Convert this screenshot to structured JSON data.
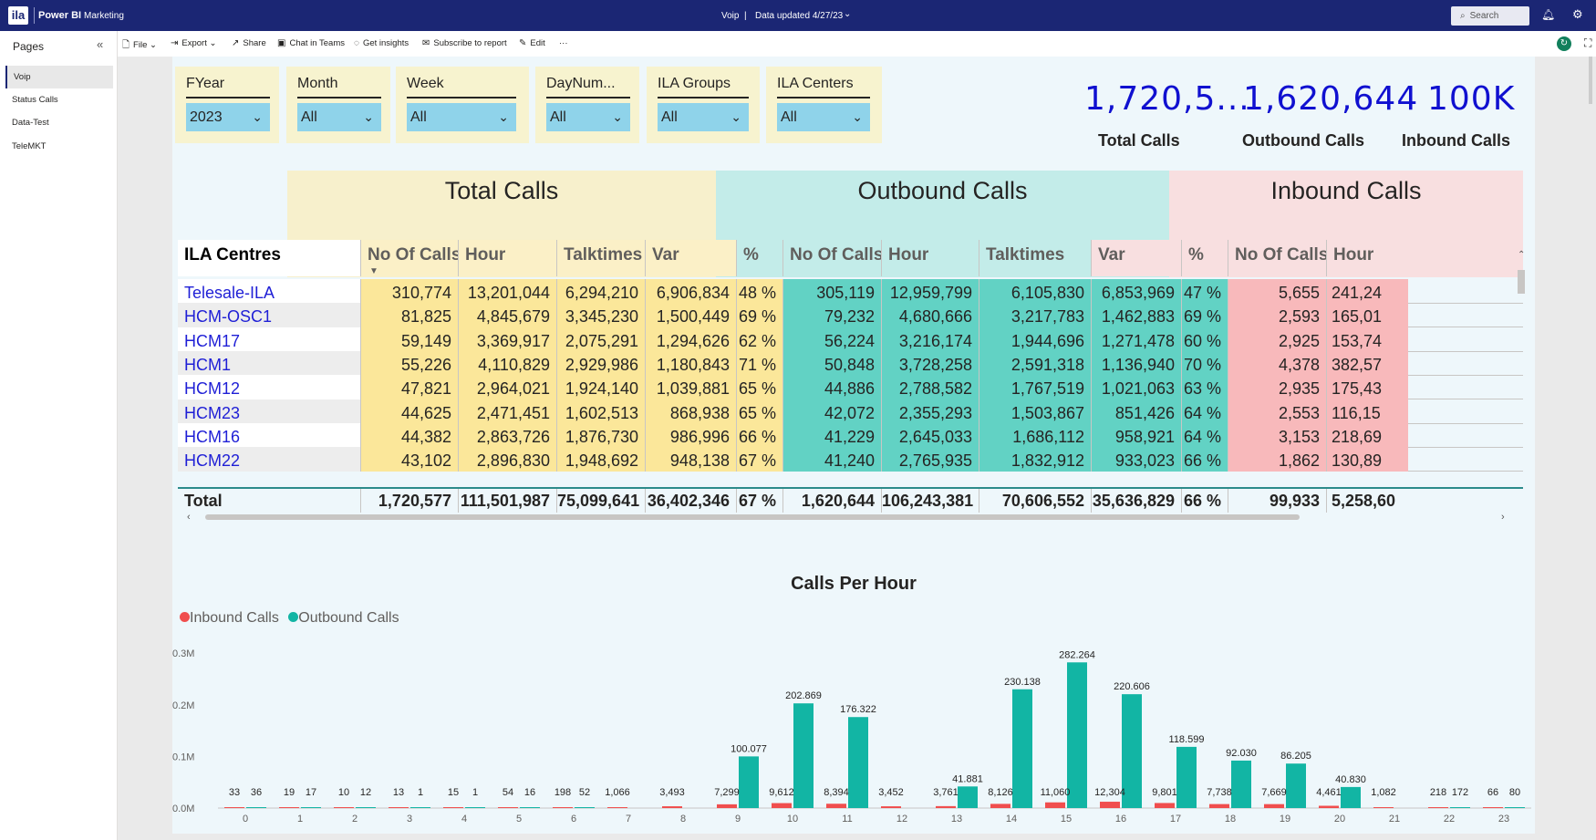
{
  "app": {
    "logo_text": "ila",
    "name": "Power BI",
    "workspace": "Marketing"
  },
  "report": {
    "title": "Voip",
    "separator": "|",
    "data_updated": "Data updated 4/27/23"
  },
  "search": {
    "placeholder": "Search"
  },
  "pages": {
    "title": "Pages",
    "items": [
      {
        "label": "Voip"
      },
      {
        "label": "Status Calls"
      },
      {
        "label": "Data-Test"
      },
      {
        "label": "TeleMKT"
      }
    ]
  },
  "toolbar": {
    "file": "File",
    "export": "Export",
    "share": "Share",
    "teams": "Chat in Teams",
    "insights": "Get insights",
    "subscribe": "Subscribe to report",
    "edit": "Edit",
    "more": "···"
  },
  "slicers": [
    {
      "title": "FYear",
      "value": "2023"
    },
    {
      "title": "Month",
      "value": "All"
    },
    {
      "title": "Week",
      "value": "All"
    },
    {
      "title": "DayNum...",
      "value": "All"
    },
    {
      "title": "ILA Groups",
      "value": "All"
    },
    {
      "title": "ILA Centers",
      "value": "All"
    }
  ],
  "kpis": [
    {
      "value": "1,720,5...",
      "label": "Total Calls"
    },
    {
      "value": "1,620,644",
      "label": "Outbound Calls"
    },
    {
      "value": "100K",
      "label": "Inbound Calls"
    }
  ],
  "matrix": {
    "group_titles": {
      "total": "Total Calls",
      "outbound": "Outbound Calls",
      "inbound": "Inbound Calls"
    },
    "columns": [
      "ILA Centres",
      "No Of Calls",
      "Hour",
      "Talktimes",
      "Var",
      "%",
      "No Of Calls",
      "Hour",
      "Talktimes",
      "Var",
      "%",
      "No Of Calls",
      "Hour"
    ],
    "rows": [
      {
        "name": "Telesale-ILA",
        "values": [
          "310,774",
          "13,201,044",
          "6,294,210",
          "6,906,834",
          "48 %",
          "305,119",
          "12,959,799",
          "6,105,830",
          "6,853,969",
          "47 %",
          "5,655",
          "241,24"
        ]
      },
      {
        "name": "HCM-OSC1",
        "values": [
          "81,825",
          "4,845,679",
          "3,345,230",
          "1,500,449",
          "69 %",
          "79,232",
          "4,680,666",
          "3,217,783",
          "1,462,883",
          "69 %",
          "2,593",
          "165,01"
        ]
      },
      {
        "name": "HCM17",
        "values": [
          "59,149",
          "3,369,917",
          "2,075,291",
          "1,294,626",
          "62 %",
          "56,224",
          "3,216,174",
          "1,944,696",
          "1,271,478",
          "60 %",
          "2,925",
          "153,74"
        ]
      },
      {
        "name": "HCM1",
        "values": [
          "55,226",
          "4,110,829",
          "2,929,986",
          "1,180,843",
          "71 %",
          "50,848",
          "3,728,258",
          "2,591,318",
          "1,136,940",
          "70 %",
          "4,378",
          "382,57"
        ]
      },
      {
        "name": "HCM12",
        "values": [
          "47,821",
          "2,964,021",
          "1,924,140",
          "1,039,881",
          "65 %",
          "44,886",
          "2,788,582",
          "1,767,519",
          "1,021,063",
          "63 %",
          "2,935",
          "175,43"
        ]
      },
      {
        "name": "HCM23",
        "values": [
          "44,625",
          "2,471,451",
          "1,602,513",
          "868,938",
          "65 %",
          "42,072",
          "2,355,293",
          "1,503,867",
          "851,426",
          "64 %",
          "2,553",
          "116,15"
        ]
      },
      {
        "name": "HCM16",
        "values": [
          "44,382",
          "2,863,726",
          "1,876,730",
          "986,996",
          "66 %",
          "41,229",
          "2,645,033",
          "1,686,112",
          "958,921",
          "64 %",
          "3,153",
          "218,69"
        ]
      },
      {
        "name": "HCM22",
        "values": [
          "43,102",
          "2,896,830",
          "1,948,692",
          "948,138",
          "67 %",
          "41,240",
          "2,765,935",
          "1,832,912",
          "933,023",
          "66 %",
          "1,862",
          "130,89"
        ]
      }
    ],
    "total": {
      "name": "Total",
      "values": [
        "1,720,577",
        "111,501,987",
        "75,099,641",
        "36,402,346",
        "67 %",
        "1,620,644",
        "106,243,381",
        "70,606,552",
        "35,636,829",
        "66 %",
        "99,933",
        "5,258,60"
      ]
    }
  },
  "colors": {
    "total_header": "#f7f0cc",
    "total_cells": "#fbe79a",
    "outbound_cells": "#62d2c4",
    "inbound_cells": "#f8b9bb",
    "inbound_series": "#f04e4e",
    "outbound_series": "#12b5a4",
    "kpi_blue": "#1010d0"
  },
  "chart_data": {
    "type": "bar",
    "title": "Calls Per Hour",
    "legend": [
      "Inbound Calls",
      "Outbound Calls"
    ],
    "legend_position": "top-left",
    "categories": [
      "0",
      "1",
      "2",
      "3",
      "4",
      "5",
      "6",
      "7",
      "8",
      "9",
      "10",
      "11",
      "12",
      "13",
      "14",
      "15",
      "16",
      "17",
      "18",
      "19",
      "20",
      "21",
      "22",
      "23"
    ],
    "series": [
      {
        "name": "Inbound Calls",
        "values": [
          33,
          19,
          10,
          13,
          15,
          54,
          198,
          1066,
          3493,
          7299,
          9612,
          8394,
          3452,
          3761,
          8126,
          11060,
          12304,
          9801,
          7738,
          7669,
          4461,
          1082,
          218,
          66
        ],
        "labels": [
          "33",
          "19",
          "10",
          "13",
          "15",
          "54",
          "198",
          "1,066",
          "3,493",
          "7,299",
          "9,612",
          "8,394",
          "3,452",
          "3,761",
          "8,126",
          "11,060",
          "12,304",
          "9,801",
          "7,738",
          "7,669",
          "4,461",
          "1,082",
          "218",
          "66"
        ]
      },
      {
        "name": "Outbound Calls",
        "values": [
          36,
          17,
          12,
          1,
          1,
          16,
          52,
          null,
          null,
          100077,
          202869,
          176322,
          null,
          41881,
          230138,
          282264,
          220606,
          118599,
          92030,
          86205,
          40830,
          null,
          172,
          80
        ],
        "labels": [
          "36",
          "17",
          "12",
          "1",
          "1",
          "16",
          "52",
          "",
          "",
          "100.077",
          "202.869",
          "176.322",
          "",
          "41.881",
          "230.138",
          "282.264",
          "220.606",
          "118.599",
          "92.030",
          "86.205",
          "40.830",
          "",
          "172",
          "80"
        ]
      }
    ],
    "y_ticks": [
      "0.0M",
      "0.1M",
      "0.2M",
      "0.3M"
    ],
    "ylim": [
      0,
      300000
    ],
    "grid": false
  }
}
